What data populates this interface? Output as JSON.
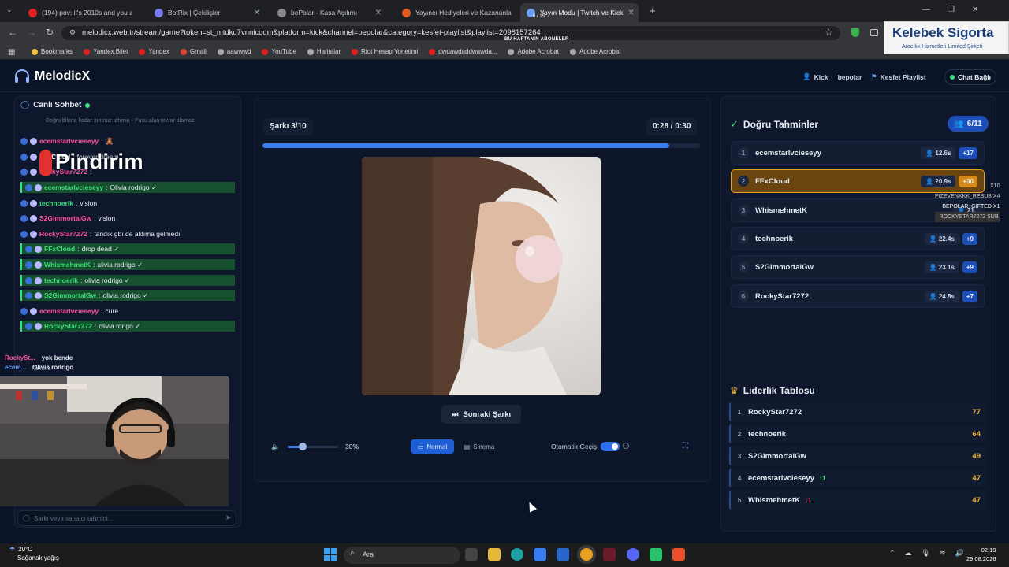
{
  "browser": {
    "tabs": [
      {
        "title": "(194) pov: it's 2010s and you a",
        "color": "#e02020"
      },
      {
        "title": "BotRix | Çekilişler",
        "color": "#7a7af0"
      },
      {
        "title": "bePolar - Kasa Açılımı",
        "color": "#888888"
      },
      {
        "title": "Yayıncı Hediyeleri ve Kazananla",
        "color": "#e05a20"
      },
      {
        "title": "Yayın Modu | Twitch ve Kick",
        "color": "#6aa0f0"
      }
    ],
    "url": "melodicx.web.tr/stream/game?token=st_mtdko7vnnicqdm&platform=kick&channel=bepolar&category=kesfet-playlist&playlist=2098157264",
    "bookmarks": [
      "Bookmarks",
      "Yandex.Bilet",
      "Yandex",
      "Gmail",
      "aawwwd",
      "YouTube",
      "Haritalar",
      "Riot Hesap Yonetimi",
      "dwdawdaddwawda...",
      "Adobe Acrobat",
      "Adobe Acrobat"
    ],
    "overlay_top": "BU HAFTANIN ABONELER",
    "overlay_count": "6 / 15"
  },
  "ad": {
    "title": "Kelebek Sigorta",
    "subtitle": "Aracılık Hizmetleri Limited Şirketi"
  },
  "app": {
    "logo": "MelodicX",
    "header": {
      "platform": "Kick",
      "channel": "bepolar",
      "playlist": "Kesfet Playlist",
      "chat_status": "Chat Bağlı"
    }
  },
  "chat": {
    "title": "Canlı Sohbet",
    "subtitle": "Doğru bilene kadar sınırsız tahmin • Pusu alan tekrar alamaz",
    "messages": [
      {
        "user": "ecemstarlvcieseyy",
        "text": "🧸",
        "ok": false,
        "color": "#ff4fa3"
      },
      {
        "user": "FFxCloud",
        "text": "forever dream",
        "ok": false,
        "color": "#ffffff"
      },
      {
        "user": "RockyStar7272",
        "text": "",
        "ok": false,
        "color": "#ff4fa3"
      },
      {
        "user": "ecemstarlvcieseyy",
        "text": "Olivia rodrigo ✓",
        "ok": true,
        "color": "#3be07a"
      },
      {
        "user": "technoerik",
        "text": "vision",
        "ok": false,
        "color": "#3be07a"
      },
      {
        "user": "S2GimmortalGw",
        "text": "vision",
        "ok": false,
        "color": "#ff4fa3"
      },
      {
        "user": "RockyStar7272",
        "text": "tandık gbı de aklıma gelmedı",
        "ok": false,
        "color": "#ff4fa3"
      },
      {
        "user": "FFxCloud",
        "text": "drop dead ✓",
        "ok": true,
        "color": "#3be07a"
      },
      {
        "user": "WhismehmetK",
        "text": "alivia rodrigo ✓",
        "ok": true,
        "color": "#3be07a"
      },
      {
        "user": "technoerik",
        "text": "olivia rodrigo ✓",
        "ok": true,
        "color": "#3be07a"
      },
      {
        "user": "S2GimmortalGw",
        "text": "olivia rodrigo ✓",
        "ok": true,
        "color": "#3be07a"
      },
      {
        "user": "ecemstarlvcieseyy",
        "text": "cure",
        "ok": false,
        "color": "#ff4fa3"
      },
      {
        "user": "RockyStar7272",
        "text": "olivia rdrigo ✓",
        "ok": true,
        "color": "#3be07a"
      }
    ],
    "overlay_sponsor": "Pindirim",
    "stream_lines": [
      {
        "user": "RockySt...",
        "text": "yok bende"
      },
      {
        "user": "ecem...",
        "text": "Olivia rodrigo"
      }
    ],
    "camera_label": "Kamera",
    "input_placeholder": "Şarkı veya sanatçı tahmini..."
  },
  "player": {
    "song_label": "Şarkı 3/10",
    "time_current": "0:28",
    "time_sep": "/",
    "time_total": "0:30",
    "progress": 0.93,
    "next_label": "Sonraki Şarkı",
    "volume_pct": "30%",
    "volume": 0.3,
    "mode_normal": "Normal",
    "mode_sinema": "Sinema",
    "auto_label": "Otomatik Geçiş"
  },
  "correct": {
    "title": "Doğru Tahminler",
    "count": "6/11",
    "rows": [
      {
        "rank": "1",
        "name": "ecemstarlvcieseyy",
        "time": "12.6s",
        "points": "+17",
        "highlight": false
      },
      {
        "rank": "2",
        "name": "FFxCloud",
        "time": "20.9s",
        "points": "+30",
        "highlight": true
      },
      {
        "rank": "3",
        "name": "WhismehmetK",
        "time": "21.",
        "points": "",
        "highlight": false
      },
      {
        "rank": "4",
        "name": "technoerik",
        "time": "22.4s",
        "points": "+9",
        "highlight": false
      },
      {
        "rank": "5",
        "name": "S2GimmortalGw",
        "time": "23.1s",
        "points": "+9",
        "highlight": false
      },
      {
        "rank": "6",
        "name": "RockyStar7272",
        "time": "24.8s",
        "points": "+7",
        "highlight": false
      }
    ]
  },
  "stream_overlay": [
    "X10",
    "PIZEVENKKK_RESUB X4",
    "BEPOLAR_GIFTED X1",
    "ROCKYSTAR7272 SUB"
  ],
  "leaderboard": {
    "title": "Liderlik Tablosu",
    "rows": [
      {
        "rank": "1",
        "name": "RockyStar7272",
        "score": "77",
        "delta": "",
        "dir": ""
      },
      {
        "rank": "2",
        "name": "technoerik",
        "score": "64",
        "delta": "",
        "dir": ""
      },
      {
        "rank": "3",
        "name": "S2GimmortalGw",
        "score": "49",
        "delta": "",
        "dir": ""
      },
      {
        "rank": "4",
        "name": "ecemstarlvcieseyy",
        "score": "47",
        "delta": "↑1",
        "dir": "up"
      },
      {
        "rank": "5",
        "name": "WhismehmetK",
        "score": "47",
        "delta": "↓1",
        "dir": "dn"
      }
    ]
  },
  "taskbar": {
    "weather_temp": "20°C",
    "weather_desc": "Sağanak yağış",
    "search": "Ara",
    "time": "02:19",
    "date": "29.08.2026"
  }
}
